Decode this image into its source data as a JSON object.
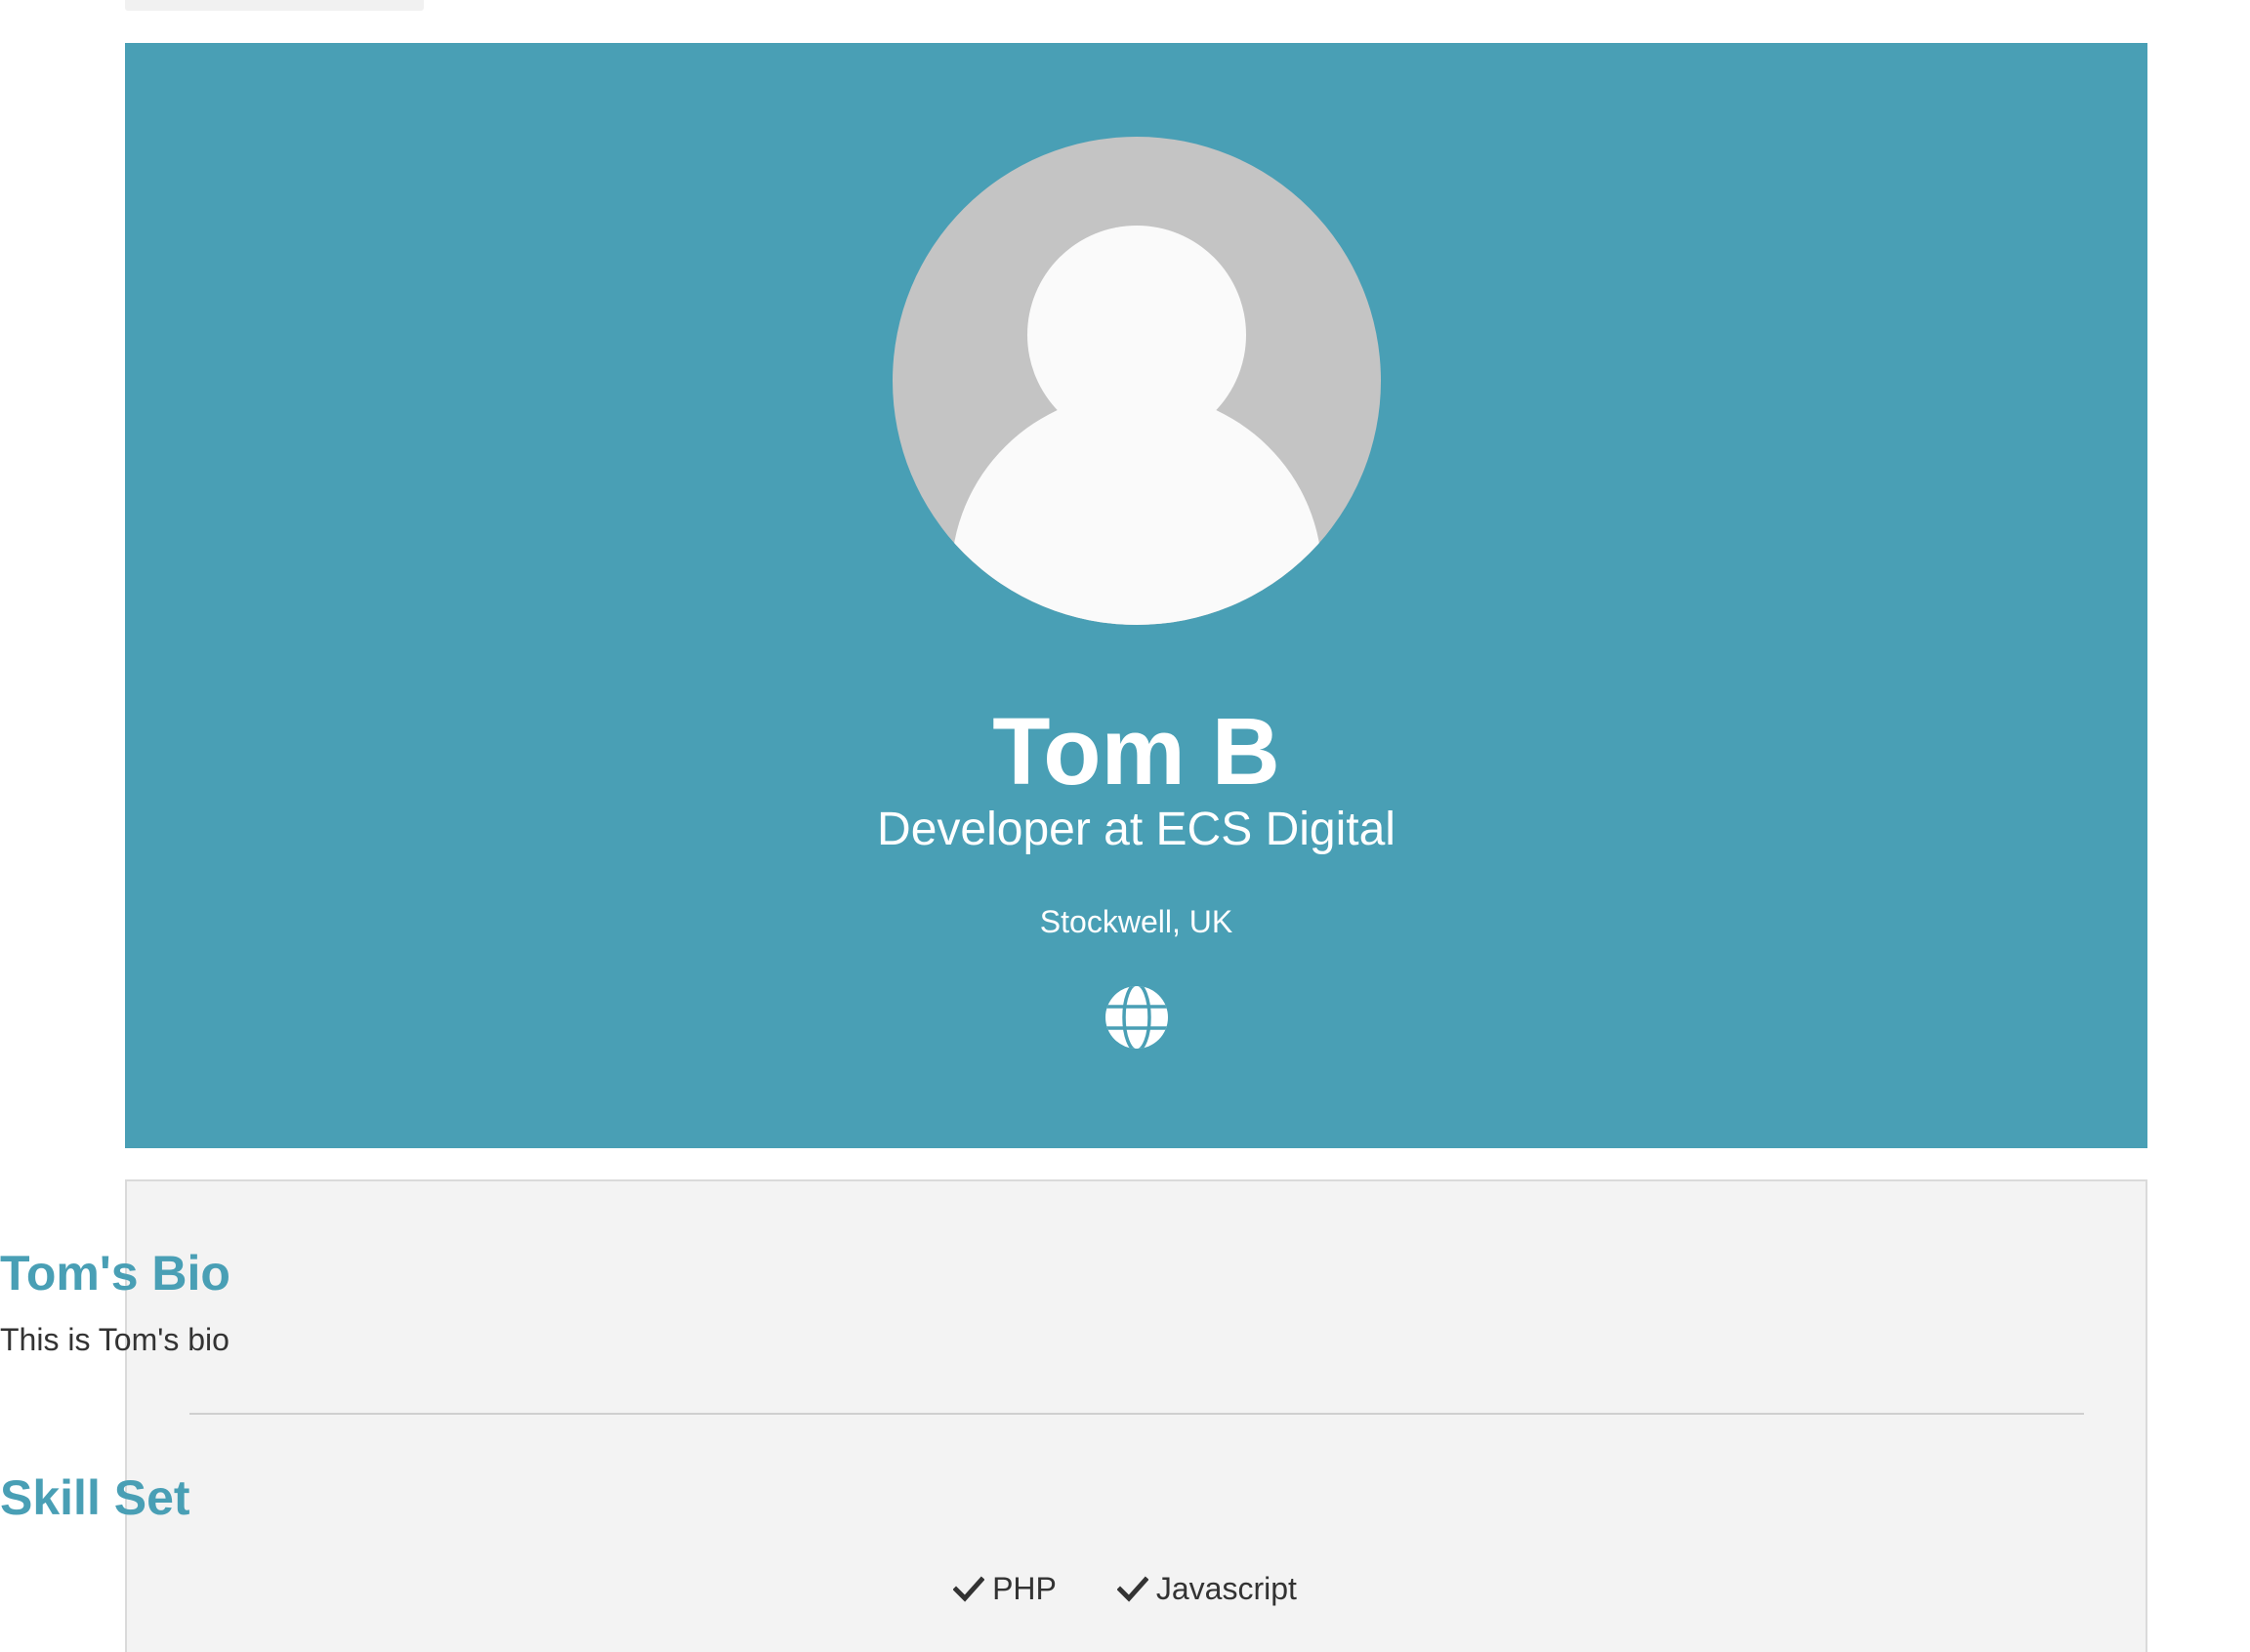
{
  "profile": {
    "name": "Tom B",
    "title": "Developer at ECS Digital",
    "location": "Stockwell, UK",
    "website_icon": "globe-icon",
    "avatar_icon": "default-avatar-icon"
  },
  "bio": {
    "heading": "Tom's Bio",
    "text": "This is Tom's bio"
  },
  "skills": {
    "heading": "Skill Set",
    "items": [
      {
        "label": "PHP",
        "icon": "check-icon"
      },
      {
        "label": "Javascript",
        "icon": "check-icon"
      }
    ]
  },
  "colors": {
    "primary": "#499fb5",
    "section_bg": "#f3f3f3",
    "text_dark": "#333333",
    "avatar_bg": "#c4c4c4",
    "avatar_figure": "#fafafa"
  }
}
